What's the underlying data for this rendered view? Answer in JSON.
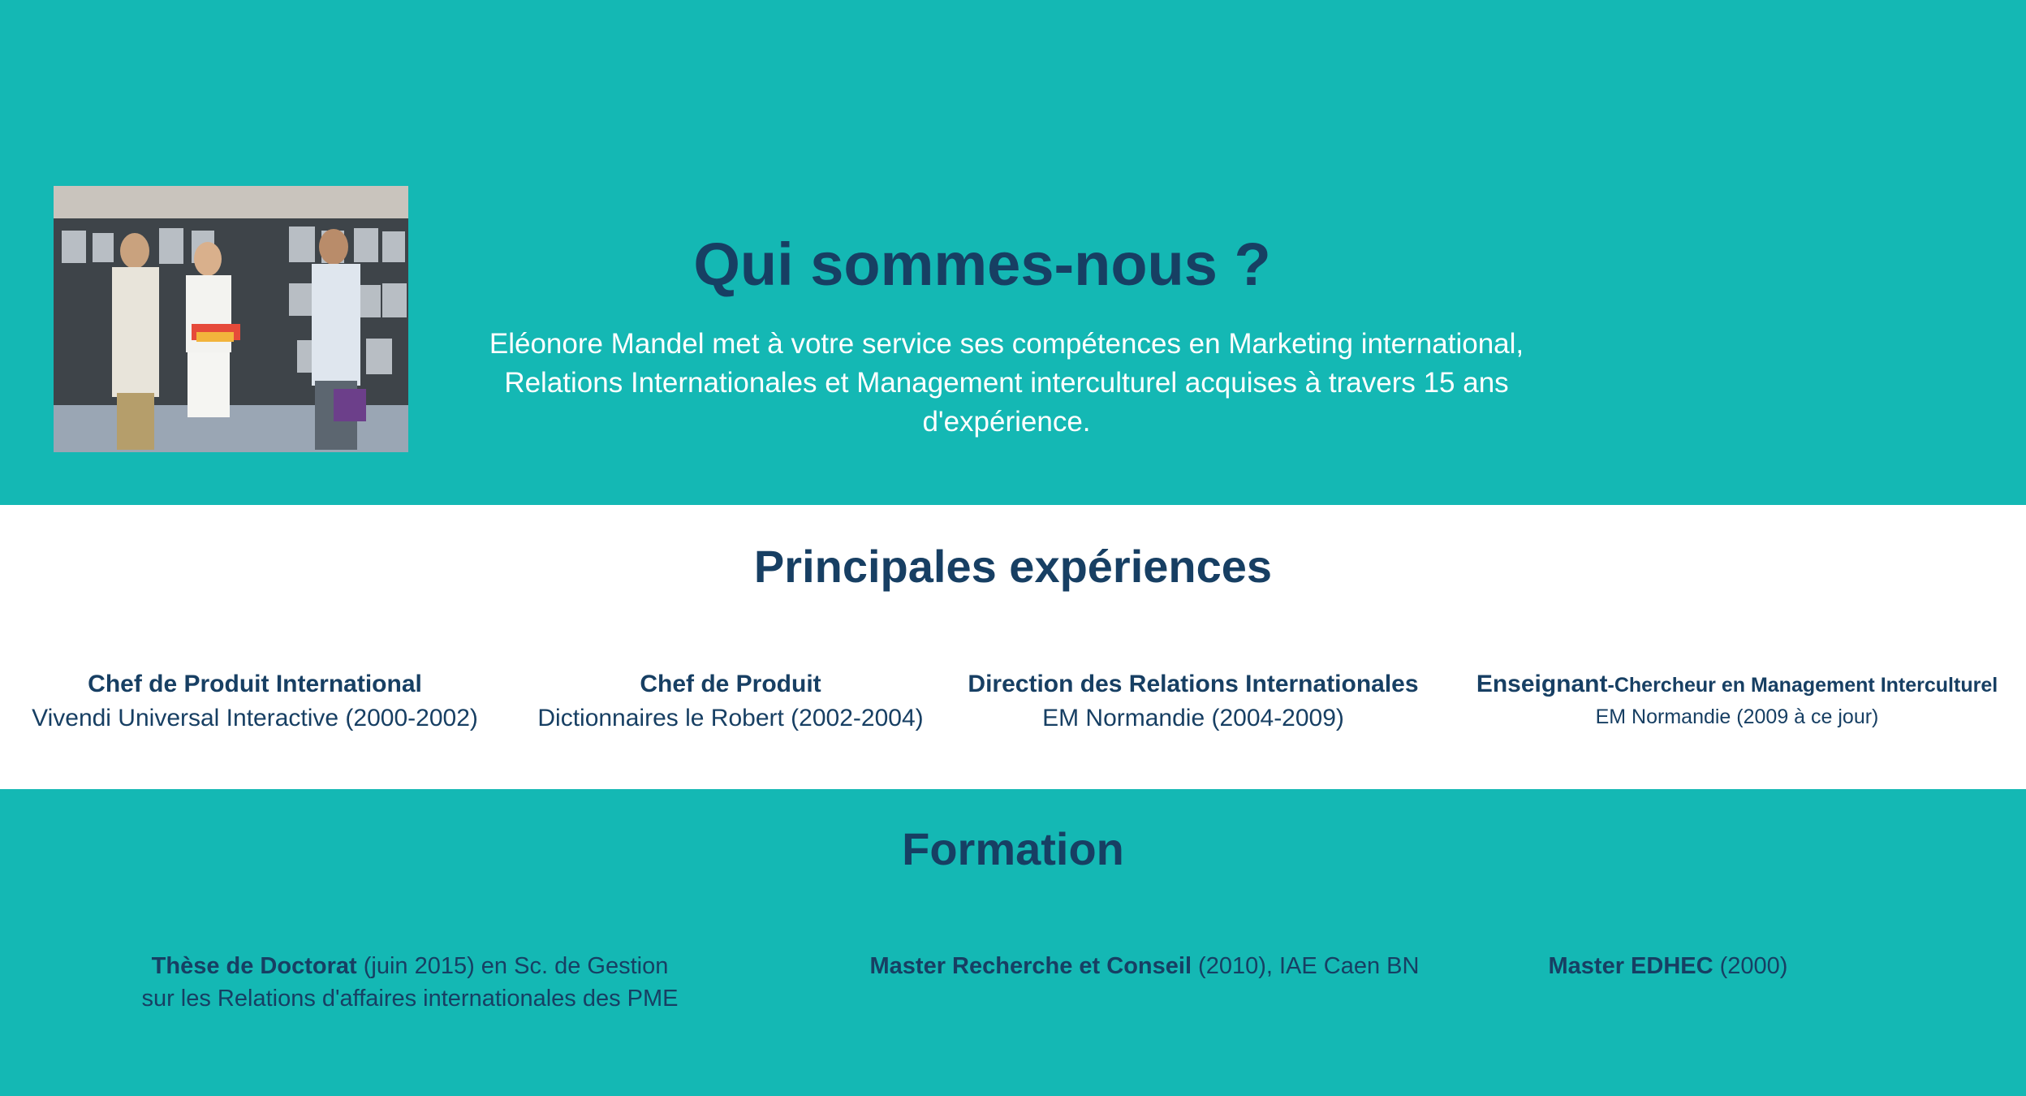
{
  "hero": {
    "title": "Qui sommes-nous ?",
    "intro_lines": [
      "Eléonore Mandel met à votre service ses compétences en Marketing international,",
      "Relations Internationales et Management interculturel acquises à travers 15 ans",
      "d'expérience."
    ]
  },
  "experiences": {
    "title": "Principales expériences",
    "items": [
      {
        "title": "Chef de Produit International",
        "detail": "Vivendi Universal Interactive (2000-2002)"
      },
      {
        "title": "Chef de Produit",
        "detail": "Dictionnaires le Robert (2002-2004)"
      },
      {
        "title": "Direction des Relations Internationales",
        "detail": "EM Normandie (2004-2009)"
      },
      {
        "title_main": "Enseignant",
        "title_rest": "-Chercheur en Management Interculturel",
        "detail": "EM Normandie (2009 à ce jour)"
      }
    ]
  },
  "formation": {
    "title": "Formation",
    "items": [
      {
        "bold": "Thèse de Doctorat",
        "rest": " (juin 2015) en Sc. de Gestion",
        "line2": "sur les Relations d'affaires internationales des PME"
      },
      {
        "bold": "Master Recherche et Conseil",
        "rest": " (2010), IAE Caen BN"
      },
      {
        "bold": "Master EDHEC",
        "rest": " (2000)"
      }
    ]
  },
  "colors": {
    "teal": "#14b8b4",
    "navy": "#173f63",
    "white": "#ffffff"
  }
}
